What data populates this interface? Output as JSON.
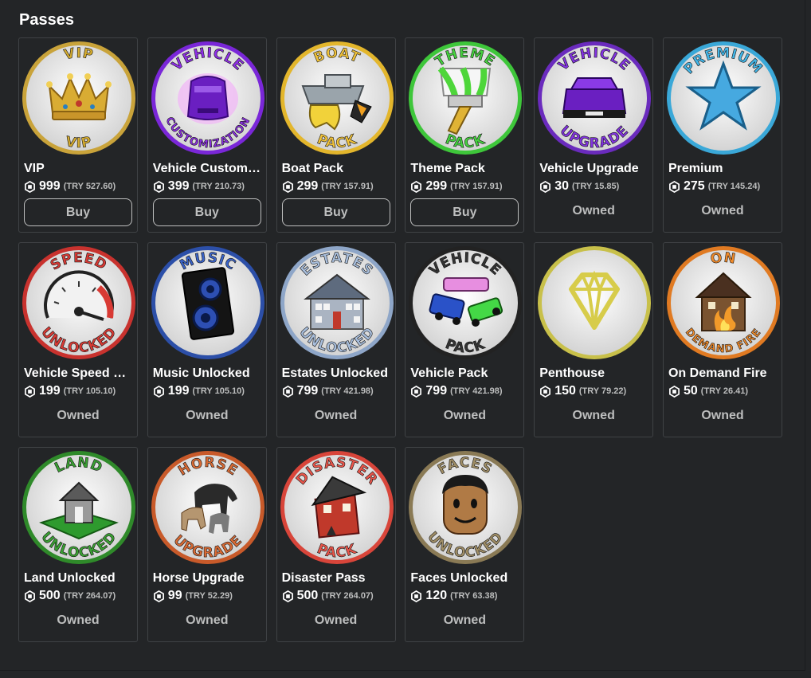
{
  "section": {
    "title": "Passes"
  },
  "passes": [
    {
      "name": "VIP",
      "robux": "999",
      "local_price": "(TRY 527.60)",
      "status": "Buy",
      "icon": "crown-icon",
      "badge_top": "VIP",
      "badge_bottom": "VIP",
      "ring": "#c9a33a",
      "accent": "#d4ab2f"
    },
    {
      "name": "Vehicle Customiz...",
      "robux": "399",
      "local_price": "(TRY 210.73)",
      "status": "Buy",
      "icon": "purple-car-glow-icon",
      "badge_top": "VEHICLE",
      "badge_bottom": "CUSTOMIZATION",
      "ring": "#7a27d8",
      "accent": "#8e2fe6"
    },
    {
      "name": "Boat Pack",
      "robux": "299",
      "local_price": "(TRY 157.91)",
      "status": "Buy",
      "icon": "boat-icon",
      "badge_top": "BOAT",
      "badge_bottom": "PACK",
      "ring": "#e3b62c",
      "accent": "#f0c23a"
    },
    {
      "name": "Theme Pack",
      "robux": "299",
      "local_price": "(TRY 157.91)",
      "status": "Buy",
      "icon": "paintbrush-icon",
      "badge_top": "THEME",
      "badge_bottom": "PACK",
      "ring": "#3ec63a",
      "accent": "#46d13f"
    },
    {
      "name": "Vehicle Upgrade",
      "robux": "30",
      "local_price": "(TRY 15.85)",
      "status": "Owned",
      "icon": "purple-car-icon",
      "badge_top": "VEHICLE",
      "badge_bottom": "UPGRADE",
      "ring": "#6a2bbd",
      "accent": "#8233e0"
    },
    {
      "name": "Premium",
      "robux": "275",
      "local_price": "(TRY 145.24)",
      "status": "Owned",
      "icon": "star-icon",
      "badge_top": "PREMIUM",
      "badge_bottom": "",
      "ring": "#3aa8d8",
      "accent": "#43b6e8"
    },
    {
      "name": "Vehicle Speed U...",
      "robux": "199",
      "local_price": "(TRY 105.10)",
      "status": "Owned",
      "icon": "speedometer-icon",
      "badge_top": "SPEED",
      "badge_bottom": "UNLOCKED",
      "ring": "#c8322e",
      "accent": "#d83a34"
    },
    {
      "name": "Music Unlocked",
      "robux": "199",
      "local_price": "(TRY 105.10)",
      "status": "Owned",
      "icon": "speaker-icon",
      "badge_top": "MUSIC",
      "badge_bottom": "",
      "ring": "#2c4fa8",
      "accent": "#3a63c8"
    },
    {
      "name": "Estates Unlocked",
      "robux": "799",
      "local_price": "(TRY 421.98)",
      "status": "Owned",
      "icon": "mansion-icon",
      "badge_top": "ESTATES",
      "badge_bottom": "UNLOCKED",
      "ring": "#8ea6c8",
      "accent": "#a8bedc"
    },
    {
      "name": "Vehicle Pack",
      "robux": "799",
      "local_price": "(TRY 421.98)",
      "status": "Owned",
      "icon": "cars-icon",
      "badge_top": "VEHICLE",
      "badge_bottom": "PACK",
      "ring": "#222222",
      "accent": "#333333"
    },
    {
      "name": "Penthouse",
      "robux": "150",
      "local_price": "(TRY 79.22)",
      "status": "Owned",
      "icon": "diamond-icon",
      "badge_top": "",
      "badge_bottom": "",
      "ring": "#c8c04a",
      "accent": "#d6cd55"
    },
    {
      "name": "On Demand Fire",
      "robux": "50",
      "local_price": "(TRY 26.41)",
      "status": "Owned",
      "icon": "burning-house-icon",
      "badge_top": "ON",
      "badge_bottom": "DEMAND FIRE",
      "ring": "#e07a22",
      "accent": "#f08a2a"
    },
    {
      "name": "Land Unlocked",
      "robux": "500",
      "local_price": "(TRY 264.07)",
      "status": "Owned",
      "icon": "land-house-icon",
      "badge_top": "LAND",
      "badge_bottom": "UNLOCKED",
      "ring": "#2f8a2a",
      "accent": "#3aa033"
    },
    {
      "name": "Horse Upgrade",
      "robux": "99",
      "local_price": "(TRY 52.29)",
      "status": "Owned",
      "icon": "horses-icon",
      "badge_top": "HORSE",
      "badge_bottom": "UPGRADE",
      "ring": "#c85a2a",
      "accent": "#d86a34"
    },
    {
      "name": "Disaster Pass",
      "robux": "500",
      "local_price": "(TRY 264.07)",
      "status": "Owned",
      "icon": "broken-house-icon",
      "badge_top": "DISASTER",
      "badge_bottom": "PACK",
      "ring": "#d8453a",
      "accent": "#e8554a"
    },
    {
      "name": "Faces Unlocked",
      "robux": "120",
      "local_price": "(TRY 63.38)",
      "status": "Owned",
      "icon": "face-icon",
      "badge_top": "FACES",
      "badge_bottom": "UNLOCKED",
      "ring": "#8a7a55",
      "accent": "#a08e66"
    }
  ]
}
